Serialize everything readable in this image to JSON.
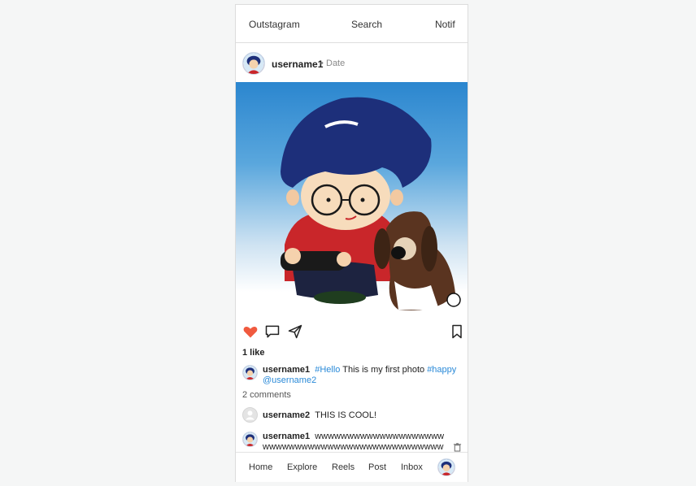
{
  "topbar": {
    "brand": "Outstagram",
    "search": "Search",
    "notif": "Notif"
  },
  "post": {
    "author": "username1",
    "separator": "•",
    "date": "Date",
    "likes": "1 like",
    "caption": {
      "author": "username1",
      "tag_hello": "#Hello",
      "text": " This is my first photo ",
      "tag_happy": "#happy",
      "mention": "@username2"
    },
    "comments_count": "2 comments",
    "comments": [
      {
        "author": "username2",
        "text": "THIS IS COOL!"
      },
      {
        "author": "username1",
        "text": "wwwwwwwwwwwwwwwwwwwwwwwwwwwwwwwwwwwwwwwwwwwwwwwwwww"
      }
    ]
  },
  "bottomnav": {
    "home": "Home",
    "explore": "Explore",
    "reels": "Reels",
    "post": "Post",
    "inbox": "Inbox"
  },
  "icons": {
    "like": "heart-icon",
    "comment": "comment-icon",
    "share": "send-icon",
    "save": "bookmark-icon",
    "delete": "trash-icon"
  },
  "colors": {
    "like": "#f05a3f",
    "link": "#2a8ad8"
  }
}
